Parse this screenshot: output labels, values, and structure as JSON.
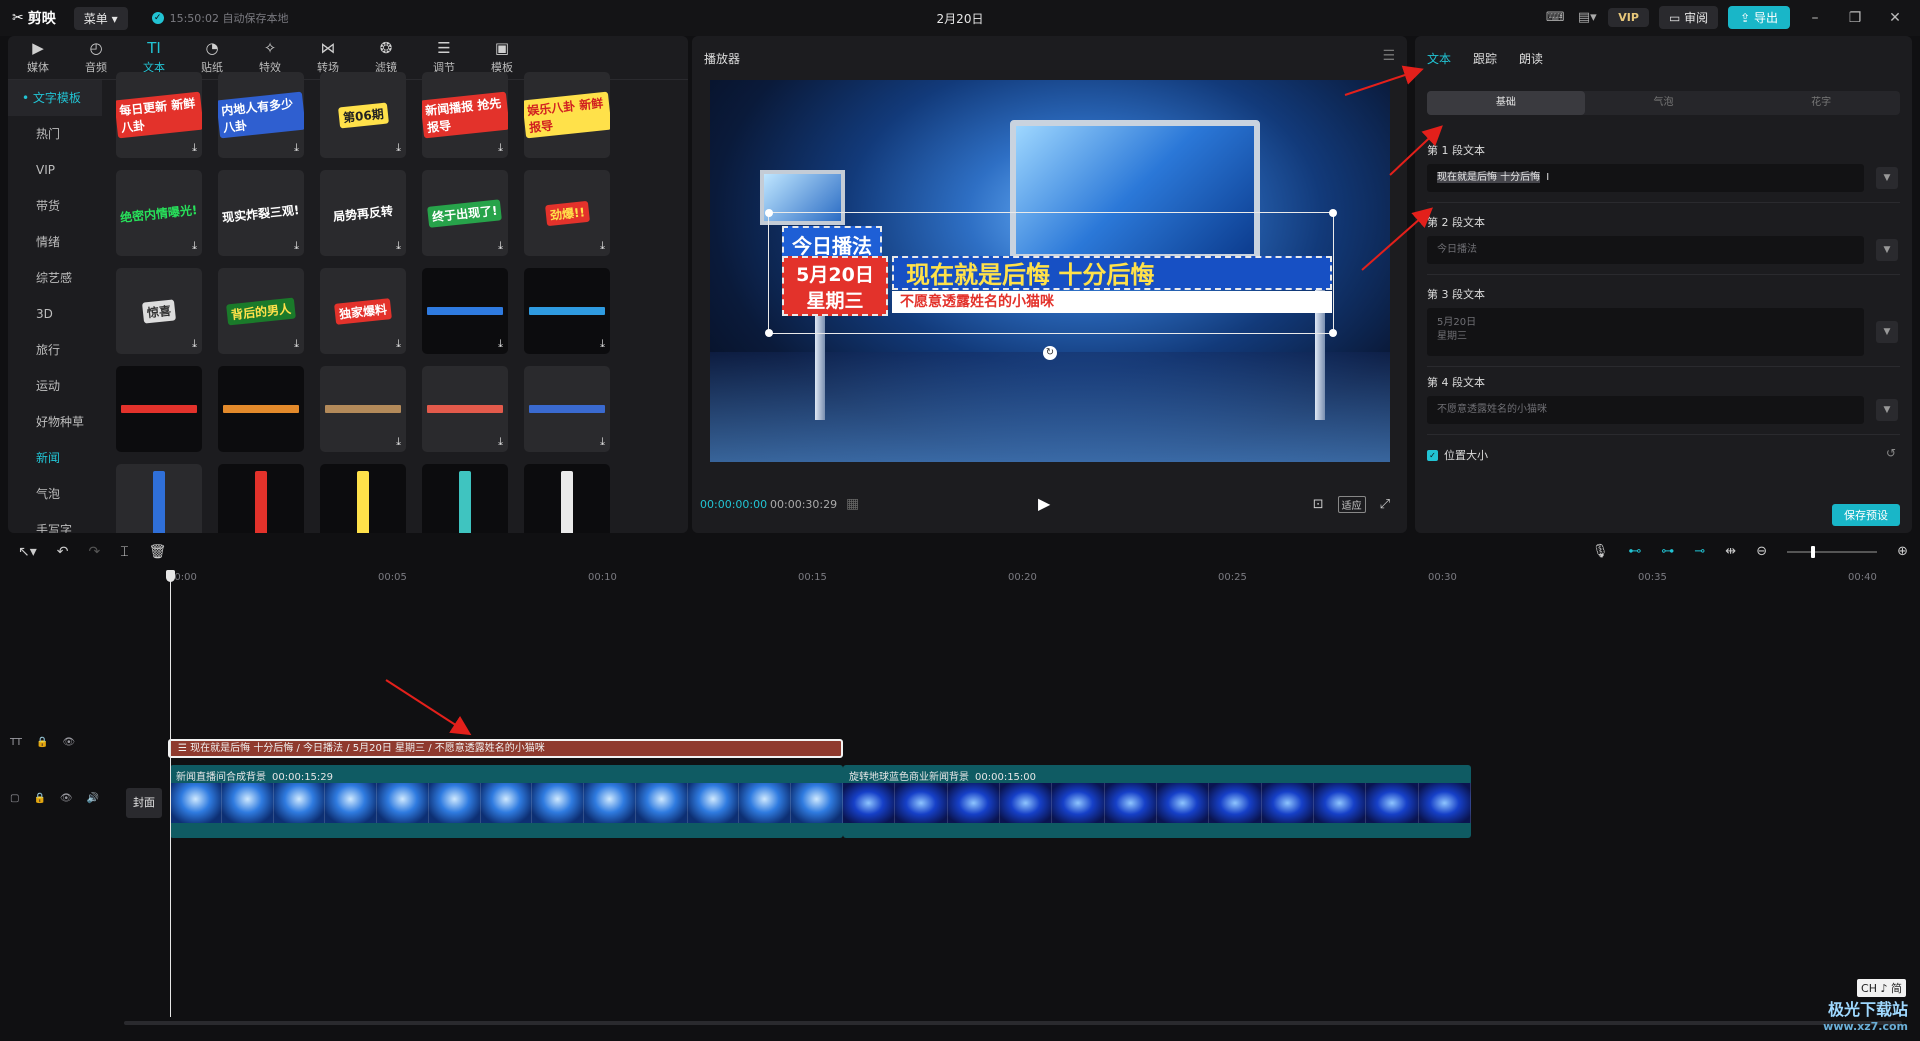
{
  "app": {
    "logo": "剪映",
    "menu_label": "菜单",
    "autosave": "15:50:02 自动保存本地",
    "project_title": "2月20日",
    "vip": "VIP",
    "review": "审阅",
    "export": "导出"
  },
  "categories": [
    {
      "label": "媒体",
      "icon": "▶"
    },
    {
      "label": "音频",
      "icon": "◴"
    },
    {
      "label": "文本",
      "icon": "TI"
    },
    {
      "label": "贴纸",
      "icon": "◔"
    },
    {
      "label": "特效",
      "icon": "✧"
    },
    {
      "label": "转场",
      "icon": "⋈"
    },
    {
      "label": "滤镜",
      "icon": "❂"
    },
    {
      "label": "调节",
      "icon": "☰"
    },
    {
      "label": "模板",
      "icon": "▣"
    }
  ],
  "side_nav": [
    "• 文字模板",
    "热门",
    "VIP",
    "带货",
    "情绪",
    "综艺感",
    "3D",
    "旅行",
    "运动",
    "好物种草",
    "新闻",
    "气泡",
    "手写字"
  ],
  "templates": [
    {
      "text": "每日更新 新鲜八卦",
      "bg": "#2a2a2d",
      "fg": "#ffffff",
      "sbg": "#e3322b"
    },
    {
      "text": "内地人有多少八卦",
      "bg": "#2a2a2d",
      "fg": "#ffffff",
      "sbg": "#2f5fd0"
    },
    {
      "text": "第06期",
      "bg": "#2a2a2d",
      "fg": "#222222",
      "sbg": "#ffe14a"
    },
    {
      "text": "新闻播报 抢先报导",
      "bg": "#2a2a2d",
      "fg": "#ffffff",
      "sbg": "#e3322b"
    },
    {
      "text": "娱乐八卦 新鲜报导",
      "bg": "#2a2a2d",
      "fg": "#d12020",
      "sbg": "#ffe14a"
    },
    {
      "text": "绝密内情曝光!",
      "bg": "#2a2a2d",
      "fg": "#27e05a",
      "sbg": "transparent"
    },
    {
      "text": "现实炸裂三观!",
      "bg": "#2a2a2d",
      "fg": "#ffffff",
      "sbg": "transparent"
    },
    {
      "text": "局势再反转",
      "bg": "#2a2a2d",
      "fg": "#ffffff",
      "sbg": "transparent"
    },
    {
      "text": "终于出现了!",
      "bg": "#2a2a2d",
      "fg": "#ffffff",
      "sbg": "#27a34a"
    },
    {
      "text": "劲爆!!",
      "bg": "#2a2a2d",
      "fg": "#ffe14a",
      "sbg": "#e3322b"
    },
    {
      "text": "惊喜",
      "bg": "#2a2a2d",
      "fg": "#333333",
      "sbg": "#dddddd"
    },
    {
      "text": "背后的男人",
      "bg": "#2a2a2d",
      "fg": "#ffe14a",
      "sbg": "#1a7a2a"
    },
    {
      "text": "独家爆料",
      "bg": "#2a2a2d",
      "fg": "#ffffff",
      "sbg": "#e3322b"
    },
    {
      "text": "",
      "bg": "#0c0c0e",
      "fg": "#ffffff",
      "sbg": "#2f7be0"
    },
    {
      "text": "",
      "bg": "#0c0c0e",
      "fg": "#ffffff",
      "sbg": "#2f9be0"
    },
    {
      "text": "",
      "bg": "#0c0c0e",
      "fg": "#ffffff",
      "sbg": "#e3322b"
    },
    {
      "text": "",
      "bg": "#0c0c0e",
      "fg": "#ffffff",
      "sbg": "#e38a2b"
    },
    {
      "text": "",
      "bg": "#2a2a2d",
      "fg": "#ffffff",
      "sbg": "#b38a5a"
    },
    {
      "text": "",
      "bg": "#2a2a2d",
      "fg": "#ffffff",
      "sbg": "#e35a4b"
    },
    {
      "text": "",
      "bg": "#2a2a2d",
      "fg": "#ffffff",
      "sbg": "#3a6ad0"
    },
    {
      "text": "",
      "bg": "#2a2a2d",
      "fg": "#ffffff",
      "sbg": "#2f6fd8"
    },
    {
      "text": "",
      "bg": "#0c0c0e",
      "fg": "#ffffff",
      "sbg": "#e3322b"
    },
    {
      "text": "",
      "bg": "#0c0c0e",
      "fg": "#ffffff",
      "sbg": "#ffe14a"
    },
    {
      "text": "",
      "bg": "#0c0c0e",
      "fg": "#ffffff",
      "sbg": "#3fc4c0"
    },
    {
      "text": "",
      "bg": "#0c0c0e",
      "fg": "#ffffff",
      "sbg": "#eaeaea"
    }
  ],
  "player": {
    "title": "播放器",
    "overlay_jinri": "今日播法",
    "overlay_date": "5月20日",
    "overlay_weekday": "星期三",
    "overlay_main": "现在就是后悔 十分后悔",
    "overlay_sub": "不愿意透露姓名的小猫咪",
    "time_current": "00:00:00:00",
    "time_total": "00:00:30:29",
    "fit": "适应"
  },
  "inspector": {
    "tabs": [
      "文本",
      "跟踪",
      "朗读"
    ],
    "segments": [
      "基础",
      "气泡",
      "花字"
    ],
    "fields": [
      {
        "label": "第 1 段文本",
        "value": "现在就是后悔 十分后悔",
        "placeholder": ""
      },
      {
        "label": "第 2 段文本",
        "value": "",
        "placeholder": "今日播法"
      },
      {
        "label": "第 3 段文本",
        "value": "",
        "placeholder": "5月20日\n星期三"
      },
      {
        "label": "第 4 段文本",
        "value": "",
        "placeholder": "不愿意透露姓名的小猫咪"
      }
    ],
    "position_size": "位置大小",
    "save_preset": "保存预设"
  },
  "timeline": {
    "ticks": [
      "00:00",
      "00:05",
      "00:10",
      "00:15",
      "00:20",
      "00:25",
      "00:30",
      "00:35",
      "00:40"
    ],
    "text_clip": "现在就是后悔 十分后悔 / 今日播法 / 5月20日 星期三 / 不愿意透露姓名的小猫咪",
    "cover": "封面",
    "clip1": {
      "name": "新闻直播间合成背景",
      "duration": "00:00:15:29"
    },
    "clip2": {
      "name": "旋转地球蓝色商业新闻背景",
      "duration": "00:00:15:00"
    }
  },
  "overlay": {
    "ime": "CH ♪ 简",
    "watermark_line1": "极光下载站",
    "watermark_line2": "www.xz7.com"
  },
  "colors": {
    "accent": "#22c3d3",
    "clip_text": "#8f3a2e",
    "clip_video": "#0f5b63",
    "annotation_arrow": "#e3201b"
  }
}
